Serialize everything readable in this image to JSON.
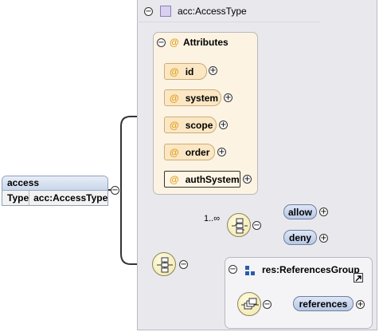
{
  "type_panel": {
    "title": "acc:AccessType"
  },
  "attributes_group": {
    "title": "Attributes",
    "items": [
      {
        "name": "id"
      },
      {
        "name": "system"
      },
      {
        "name": "scope"
      },
      {
        "name": "order"
      },
      {
        "name": "authSystem",
        "required": true
      }
    ]
  },
  "root_element": {
    "name": "access",
    "type_label": "Type",
    "type_value": "acc:AccessType"
  },
  "choice": {
    "occurrence": "1..∞",
    "elements": [
      "allow",
      "deny"
    ]
  },
  "group_ref": {
    "title": "res:ReferencesGroup",
    "elements": [
      "references"
    ]
  },
  "glyphs": {
    "collapse": "−",
    "expand": "+",
    "at": "@"
  },
  "colors": {
    "panel_bg": "#e9e9ed",
    "attr_bg": "#fdf3e2",
    "attr_pill": "#fbe7c4",
    "element_pill": "#c6d4ee",
    "compositor": "#f6eec0",
    "group_icon": "#2a5da8"
  }
}
